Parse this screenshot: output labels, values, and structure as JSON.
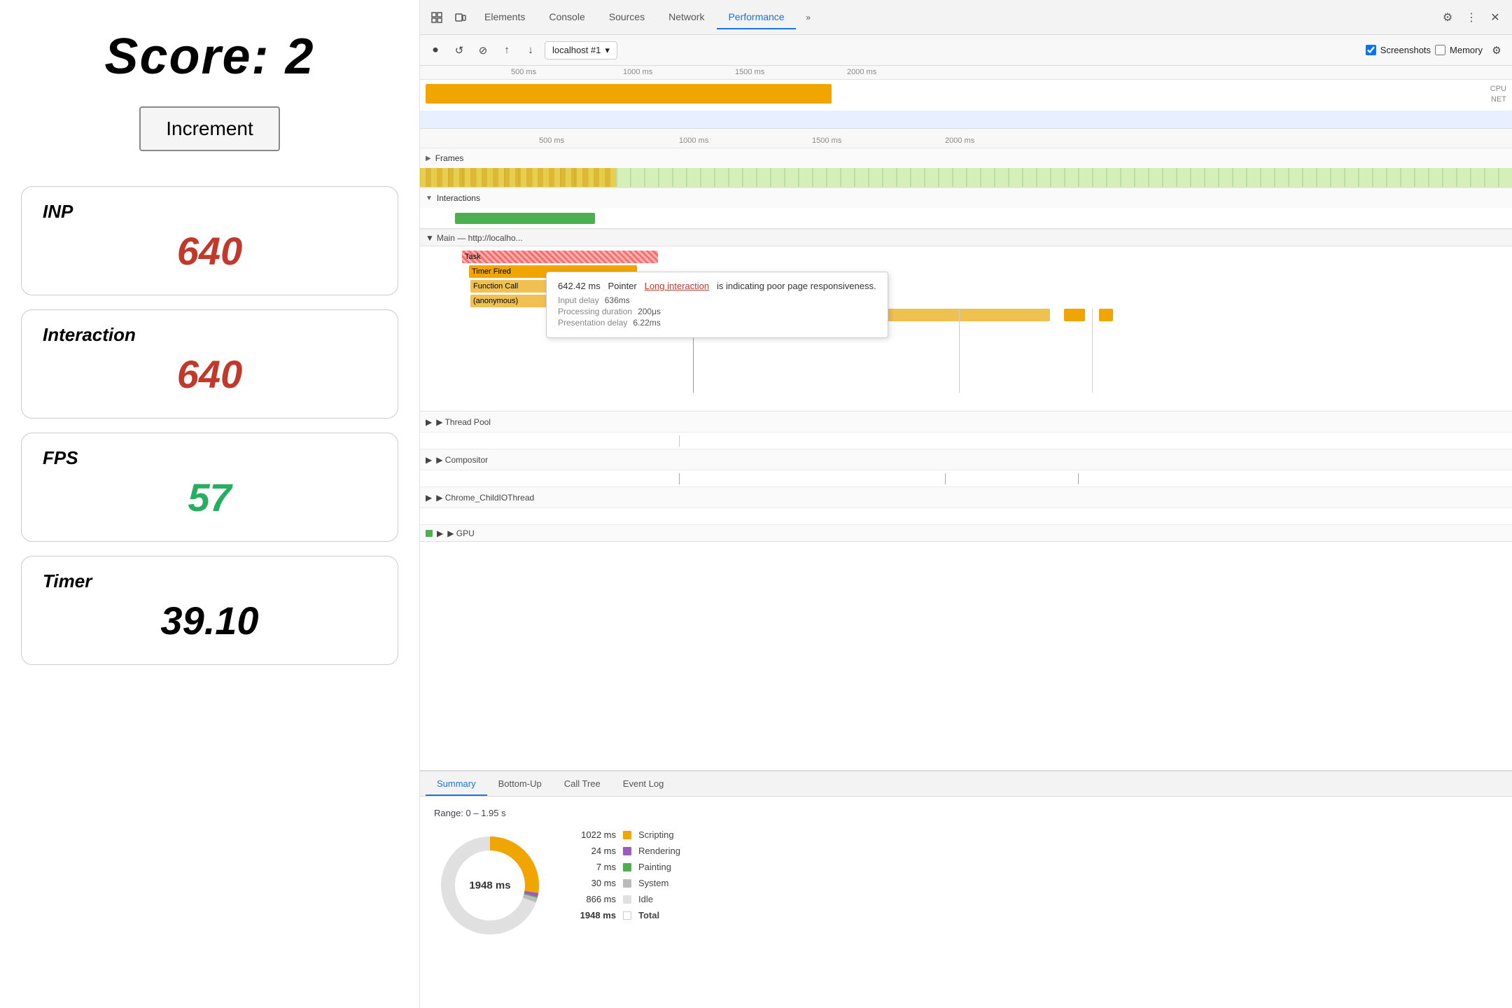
{
  "left": {
    "score_label": "Score: 2",
    "increment_label": "Increment",
    "metrics": [
      {
        "label": "INP",
        "value": "640",
        "color": "red"
      },
      {
        "label": "Interaction",
        "value": "640",
        "color": "red"
      },
      {
        "label": "FPS",
        "value": "57",
        "color": "green"
      },
      {
        "label": "Timer",
        "value": "39.10",
        "color": "black"
      }
    ]
  },
  "devtools": {
    "tabs": [
      "Elements",
      "Console",
      "Sources",
      "Network",
      "Performance"
    ],
    "active_tab": "Performance",
    "toolbar": {
      "record_label": "⏺",
      "reload_label": "↺",
      "clear_label": "⊘",
      "upload_label": "↑",
      "download_label": "↓",
      "url": "localhost #1",
      "screenshots_label": "Screenshots",
      "memory_label": "Memory"
    },
    "ruler": {
      "marks": [
        "500 ms",
        "1000 ms",
        "1500 ms",
        "2000 ms"
      ],
      "marks2": [
        "500 ms",
        "1000 ms",
        "1500 ms",
        "2000 ms"
      ]
    },
    "labels": {
      "cpu": "CPU",
      "net": "NET",
      "frames": "▶ Frames",
      "interactions": "▼ Interactions",
      "main": "▼ Main — http://localho...",
      "thread_pool": "▶ Thread Pool",
      "compositor": "▶ Compositor",
      "chrome_child": "▶ Chrome_ChildIOThread",
      "gpu": "▶ GPU"
    },
    "flame": {
      "task_label": "Task",
      "timer_label": "Timer Fired",
      "func_label": "Function Call",
      "anon_label": "(anonymous)"
    },
    "tooltip": {
      "time": "642.42 ms",
      "type": "Pointer",
      "link_text": "Long interaction",
      "description": "is indicating poor page responsiveness.",
      "input_delay_label": "Input delay",
      "input_delay_val": "636ms",
      "processing_label": "Processing duration",
      "processing_val": "200μs",
      "presentation_label": "Presentation delay",
      "presentation_val": "6.22ms"
    },
    "bottom": {
      "tabs": [
        "Summary",
        "Bottom-Up",
        "Call Tree",
        "Event Log"
      ],
      "active_tab": "Summary",
      "range": "Range: 0 – 1.95 s",
      "donut_label": "1948 ms",
      "legend": [
        {
          "val": "1022 ms",
          "color": "#f0a500",
          "name": "Scripting"
        },
        {
          "val": "24 ms",
          "color": "#9c5bbf",
          "name": "Rendering"
        },
        {
          "val": "7 ms",
          "color": "#4caf50",
          "name": "Painting"
        },
        {
          "val": "30 ms",
          "color": "#bbb",
          "name": "System"
        },
        {
          "val": "866 ms",
          "color": "#e0e0e0",
          "name": "Idle"
        },
        {
          "val": "1948 ms",
          "color": "#fff",
          "name": "Total"
        }
      ]
    }
  }
}
